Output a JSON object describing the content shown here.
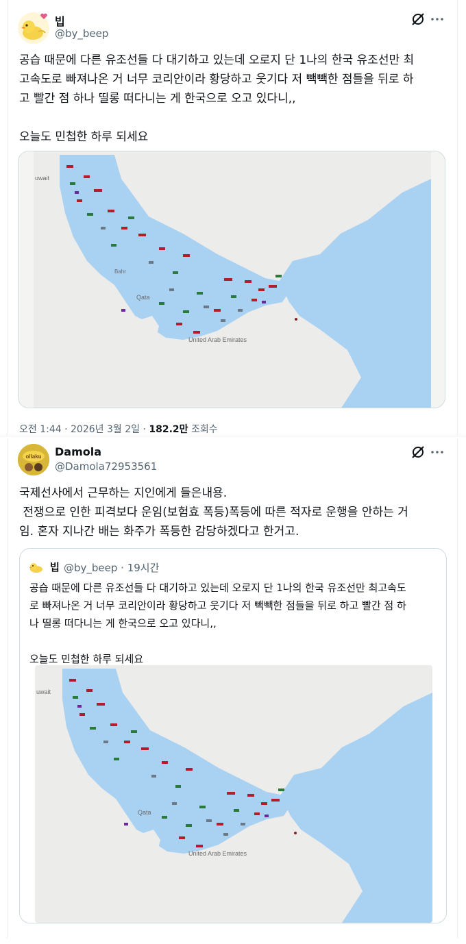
{
  "post1": {
    "name": "빕",
    "handle": "@by_beep",
    "body": "공습 때문에 다른 유조선들 다 대기하고 있는데 오로지 단 1나의 한국 유조선만 최\n고속도로 빠져나온 거 너무 코리안이라 황당하고 웃기다 저 빽빽한 점들을 뒤로 하\n고 빨간 점 하나 띨롱 떠다니는 게 한국으로 오고 있다니,,\n\n오늘도 민첩한 하루 되세요",
    "meta_time": "오전 1:44 · 2026년 3월 2일 · ",
    "meta_views": "182.2만",
    "meta_views_label": " 조회수",
    "map_labels": {
      "kuwait": "uwait",
      "qatar": "Qata",
      "bahrain": "Bahr",
      "uae": "United Arab Emirates"
    }
  },
  "post2": {
    "name": "Damola",
    "handle": "@Damola72953561",
    "avatar_text": "ollaku",
    "body": "국제선사에서 근무하는 지인에게 들은내용.\n 전쟁으로 인한 피격보다 운임(보험효 폭등)폭등에 따른 적자로 운행을 안하는 거\n임. 혼자 지나간 배는 화주가 폭등한 감당하겠다고 한거고.",
    "quote": {
      "name": "빕",
      "handle": "@by_beep",
      "time": " · 19시간",
      "body": "공습 때문에 다른 유조선들 다 대기하고 있는데 오로지 단 1나의 한국 유조선만 최고속도\n로 빠져나온 거 너무 코리안이라 황당하고 웃기다 저 빽빽한 점들을 뒤로 하고 빨간 점 하\n나 띨롱 떠다니는 게 한국으로 오고 있다니,,\n\n오늘도 민첩한 하루 되세요",
      "map_labels": {
        "kuwait": "uwait",
        "qatar": "Qata",
        "uae": "United Arab Emirates"
      }
    }
  },
  "colors": {
    "water": "#a9d1f2",
    "land": "#ececea",
    "text": "#0f1419",
    "muted": "#536471",
    "border": "#cfd9de"
  }
}
